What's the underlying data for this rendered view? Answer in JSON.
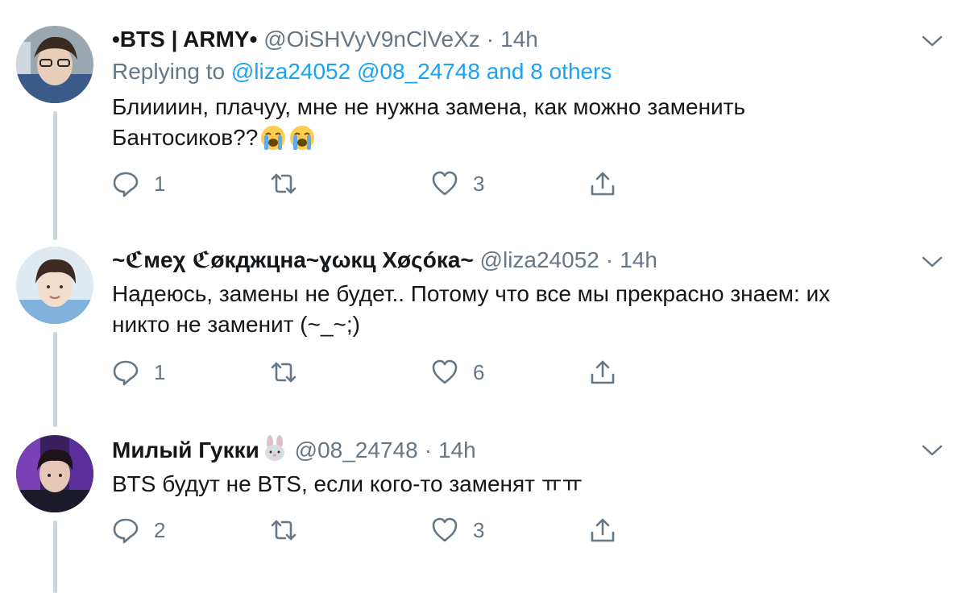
{
  "tweets": [
    {
      "display_name": "•BTS | ARMY•",
      "handle": "@OiSHVyV9nClVeXz",
      "separator": "·",
      "time": "14h",
      "replying_prefix": "Replying to",
      "replying_mentions": "@liza24052 @08_24748",
      "replying_others": "and 8 others",
      "text_line1": "Блиииин, плачуу, мне не нужна замена, как можно заменить",
      "text_line2": "Бантосиков??",
      "text_emojis": [
        "loudly-crying-face",
        "loudly-crying-face"
      ],
      "reply_count": "1",
      "retweet_count": "",
      "like_count": "3"
    },
    {
      "display_name": "~ℭмеχ ℭøкджцна~ɣωкц Χøςóка~",
      "handle": "@liza24052",
      "separator": "·",
      "time": "14h",
      "text_line1": "Надеюсь, замены не будет.. Потому что все мы прекрасно знаем: их",
      "text_line2": "никто не заменит (~_~;)",
      "reply_count": "1",
      "retweet_count": "",
      "like_count": "6"
    },
    {
      "display_name": "Милый Гукки",
      "name_emoji": "rabbit-face",
      "handle": "@08_24748",
      "separator": "·",
      "time": "14h",
      "text_line1": "BTS будут не BTS, если кого-то заменят ㅠㅠ",
      "reply_count": "2",
      "retweet_count": "",
      "like_count": "3"
    }
  ],
  "colors": {
    "text": "#14171a",
    "secondary": "#657786",
    "link": "#1da1f2",
    "thread_line": "#ccd6dd",
    "icon": "#657786"
  }
}
